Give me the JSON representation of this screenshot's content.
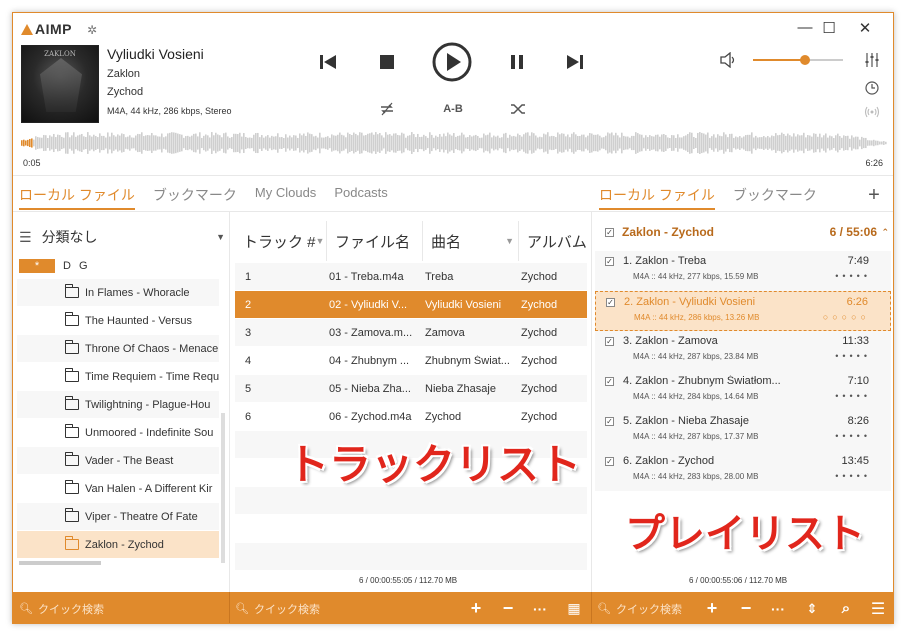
{
  "app": {
    "name": "AIMP"
  },
  "now_playing": {
    "title": "Vyliudki Vosieni",
    "album": "Zaklon",
    "artist": "Zychod",
    "format": "M4A, 44 kHz, 286 kbps, Stereo",
    "time_elapsed": "0:05",
    "time_total": "6:26",
    "cover_text": "ZAKLON",
    "volume": 0.58,
    "ab_label": "A-B"
  },
  "left_tabs": [
    "ローカル ファイル",
    "ブックマーク",
    "My Clouds",
    "Podcasts"
  ],
  "right_tabs": [
    "ローカル ファイル",
    "ブックマーク"
  ],
  "tree": {
    "grouping": "分類なし",
    "letters": [
      "*",
      "D",
      "G"
    ],
    "items": [
      "In Flames - Whoracle",
      "The Haunted - Versus",
      "Throne Of Chaos - Menace",
      "Time Requiem - Time Requ",
      "Twilightning - Plague-Hou",
      "Unmoored - Indefinite Sou",
      "Vader - The Beast",
      "Van Halen - A Different Kir",
      "Viper - Theatre Of Fate",
      "Zaklon - Zychod"
    ],
    "selected_index": 9
  },
  "tracklist": {
    "columns": [
      "トラック #",
      "ファイル名",
      "曲名",
      "アルバム"
    ],
    "rows": [
      [
        "1",
        "01 - Treba.m4a",
        "Treba",
        "Zychod"
      ],
      [
        "2",
        "02 - Vyliudki V...",
        "Vyliudki Vosieni",
        "Zychod"
      ],
      [
        "3",
        "03 - Zamova.m...",
        "Zamova",
        "Zychod"
      ],
      [
        "4",
        "04 - Zhubnym ...",
        "Zhubnym Świat...",
        "Zychod"
      ],
      [
        "5",
        "05 - Nieba Zha...",
        "Nieba Zhasaje",
        "Zychod"
      ],
      [
        "6",
        "06 - Zychod.m4a",
        "Zychod",
        "Zychod"
      ]
    ],
    "selected_index": 1,
    "summary": "6 / 00:00:55:05 / 112.70 MB"
  },
  "overlay_labels": {
    "tracklist": "トラックリスト",
    "playlist": "プレイリスト"
  },
  "playlist": {
    "group": "Zaklon - Zychod",
    "group_count": "6 / 55:06",
    "items": [
      {
        "name": "1. Zaklon - Treba",
        "duration": "7:49",
        "meta": "M4A :: 44 kHz, 277 kbps, 15.59 MB"
      },
      {
        "name": "2. Zaklon - Vyliudki Vosieni",
        "duration": "6:26",
        "meta": "M4A :: 44 kHz, 286 kbps, 13.26 MB"
      },
      {
        "name": "3. Zaklon - Zamova",
        "duration": "11:33",
        "meta": "M4A :: 44 kHz, 287 kbps, 23.84 MB"
      },
      {
        "name": "4. Zaklon - Zhubnym Światłom...",
        "duration": "7:10",
        "meta": "M4A :: 44 kHz, 284 kbps, 14.64 MB"
      },
      {
        "name": "5. Zaklon - Nieba Zhasaje",
        "duration": "8:26",
        "meta": "M4A :: 44 kHz, 287 kbps, 17.37 MB"
      },
      {
        "name": "6. Zaklon - Zychod",
        "duration": "13:45",
        "meta": "M4A :: 44 kHz, 283 kbps, 28.00 MB"
      }
    ],
    "selected_index": 1,
    "summary": "6 / 00:00:55:06 / 112.70 MB"
  },
  "search": {
    "placeholder": "クイック検索"
  },
  "colors": {
    "accent": "#e08a2c",
    "overlay_text": "#e1261c"
  }
}
